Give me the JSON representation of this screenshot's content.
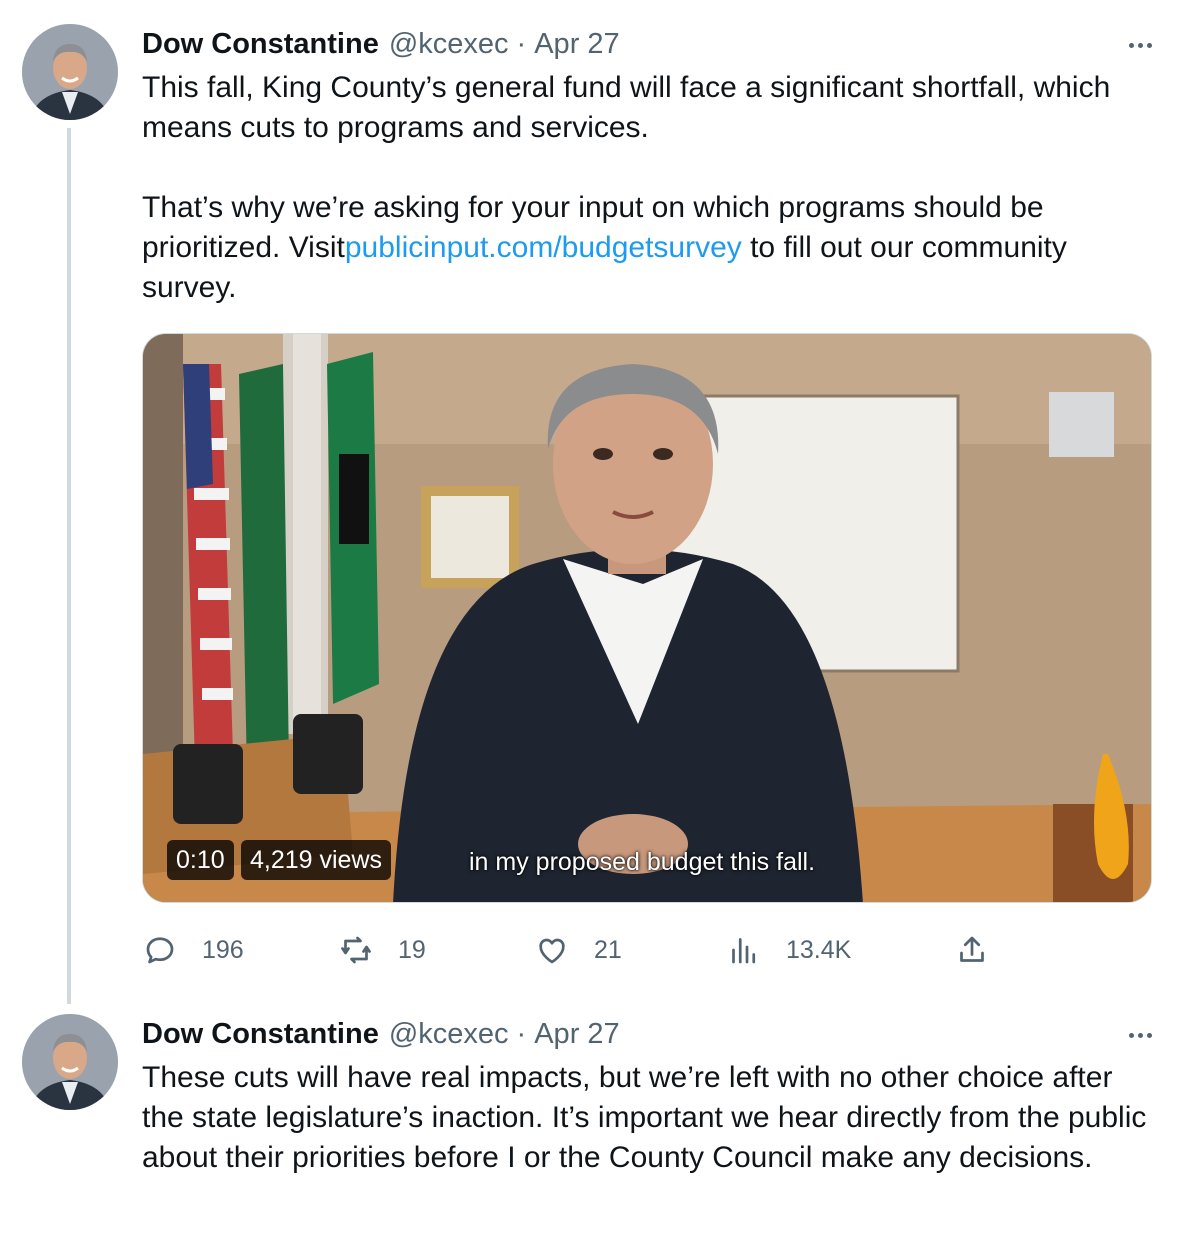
{
  "tweets": [
    {
      "author": "Dow Constantine",
      "handle": "@kcexec",
      "separator": "·",
      "date": "Apr 27",
      "text_before_link": "This fall, King County’s general fund will face a significant shortfall, which means cuts to programs and services.\n\nThat’s why we’re asking for your input on which programs should be prioritized. Visit",
      "link": "publicinput.com/budgetsurvey",
      "text_after_link": " to fill out our community survey.",
      "video": {
        "duration": "0:10",
        "views": "4,219 views",
        "caption": "in my proposed budget this fall."
      },
      "actions": {
        "replies": "196",
        "retweets": "19",
        "likes": "21",
        "views": "13.4K"
      }
    },
    {
      "author": "Dow Constantine",
      "handle": "@kcexec",
      "separator": "·",
      "date": "Apr 27",
      "text": "These cuts will have real impacts, but we’re left with no other choice after the state legislature’s inaction. It’s important we hear directly from the public about their priorities before I or the County Council make any decisions."
    }
  ],
  "icons": [
    "avatar",
    "more-icon",
    "reply-icon",
    "retweet-icon",
    "like-icon",
    "views-icon",
    "share-icon"
  ],
  "colors": {
    "link": "#1d9bf0",
    "secondary_text": "#536471",
    "thread_line": "#cfd9de"
  }
}
